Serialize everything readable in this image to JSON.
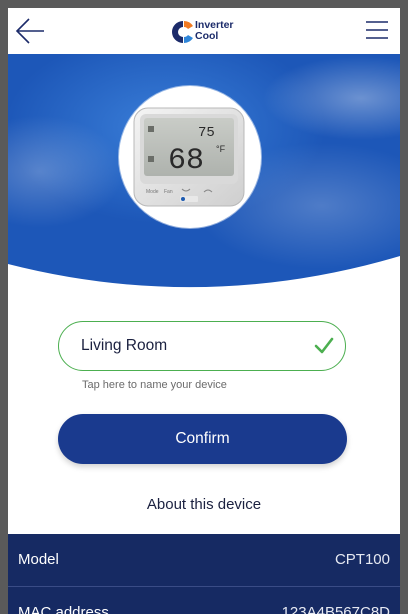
{
  "header": {
    "logo_line1": "Inverter",
    "logo_line2": "Cool",
    "back_icon": "arrow-left-icon",
    "menu_icon": "hamburger-menu-icon"
  },
  "device_image": {
    "set_temp": "75",
    "current_temp": "68",
    "unit": "°F",
    "buttons": [
      "Mode",
      "Fan"
    ]
  },
  "name_field": {
    "value": "Living Room",
    "status_icon": "check-icon",
    "hint": "Tap here to name your device"
  },
  "confirm_label": "Confirm",
  "about_label": "About this device",
  "info": [
    {
      "key": "Model",
      "value": "CPT100"
    },
    {
      "key": "MAC address",
      "value": "123A4B567C8D"
    }
  ],
  "colors": {
    "accent_green": "#4caf50",
    "primary_navy": "#1a3a8e",
    "table_navy": "#162a63",
    "hero_blue": "#2562c4"
  }
}
